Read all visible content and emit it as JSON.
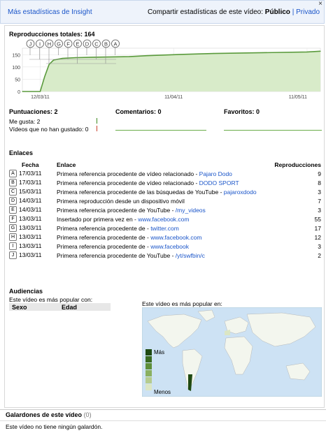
{
  "topbar": {
    "more_stats": "Más estadísticas de Insight",
    "share_label": "Compartir estadísticas de este vídeo:",
    "share_public": "Público",
    "share_sep": "|",
    "share_private": "Privado",
    "close": "×"
  },
  "views": {
    "title": "Reproducciones totales: 164",
    "markers": [
      "J",
      "I",
      "H",
      "G",
      "F",
      "E",
      "D",
      "C",
      "B",
      "A"
    ],
    "chart_data": {
      "type": "area",
      "x": [
        "08/03/11",
        "12/03/11",
        "13/03/11",
        "14/03/11",
        "15/03/11",
        "17/03/11",
        "20/03/11",
        "25/03/11",
        "01/04/11",
        "05/04/11",
        "11/04/11",
        "20/04/11",
        "01/05/11",
        "11/05/11",
        "14/05/11"
      ],
      "values": [
        0,
        0,
        60,
        110,
        128,
        135,
        138,
        140,
        142,
        146,
        150,
        155,
        158,
        161,
        164
      ],
      "yticks": [
        0,
        50,
        100,
        150
      ],
      "xticks": [
        "12/03/11",
        "11/04/11",
        "11/05/11"
      ],
      "ylim": [
        0,
        165
      ],
      "color": "#5a9a3c",
      "fill": "#d8ebc9"
    }
  },
  "ratings": {
    "score_title": "Puntuaciones: 2",
    "likes": "Me gusta: 2",
    "dislikes": "Vídeos que no han gustado: 0",
    "comments_title": "Comentarios: 0",
    "favorites_title": "Favoritos: 0"
  },
  "links": {
    "title": "Enlaces",
    "col_date": "Fecha",
    "col_link": "Enlace",
    "col_views": "Reproducciones",
    "rows": [
      {
        "letter": "A",
        "date": "17/03/11",
        "text": "Primera referencia procedente de vídeo relacionado - ",
        "link": "Pajaro Dodo",
        "views": "9"
      },
      {
        "letter": "B",
        "date": "17/03/11",
        "text": "Primera referencia procedente de vídeo relacionado - ",
        "link": "DODO SPORT",
        "views": "8"
      },
      {
        "letter": "C",
        "date": "15/03/11",
        "text": "Primera referencia procedente de las búsquedas de YouTube - ",
        "link": "pajaroxdodo",
        "views": "3"
      },
      {
        "letter": "D",
        "date": "14/03/11",
        "text": "Primera reproducción desde un dispositivo móvil",
        "link": "",
        "views": "7"
      },
      {
        "letter": "E",
        "date": "14/03/11",
        "text": "Primera referencia procedente de YouTube - ",
        "link": "/my_videos",
        "views": "3"
      },
      {
        "letter": "F",
        "date": "13/03/11",
        "text": "Insertado por primera vez en - ",
        "link": "www.facebook.com",
        "views": "55"
      },
      {
        "letter": "G",
        "date": "13/03/11",
        "text": "Primera referencia procedente de - ",
        "link": "twitter.com",
        "views": "17"
      },
      {
        "letter": "H",
        "date": "13/03/11",
        "text": "Primera referencia procedente de - ",
        "link": "www.facebook.com",
        "views": "12"
      },
      {
        "letter": "I",
        "date": "13/03/11",
        "text": "Primera referencia procedente de - ",
        "link": "www.facebook",
        "views": "3"
      },
      {
        "letter": "J",
        "date": "13/03/11",
        "text": "Primera referencia procedente de YouTube - ",
        "link": "/yt/swfbin/c",
        "views": "2"
      }
    ]
  },
  "audience": {
    "title": "Audiencias",
    "popular_with": "Este vídeo es más popular con:",
    "col_sex": "Sexo",
    "col_age": "Edad",
    "popular_in": "Este vídeo es más popular en:",
    "legend_more": "Más",
    "legend_less": "Menos",
    "legend_colors": [
      "#1f4a12",
      "#3a6b22",
      "#5e8f3a",
      "#8ab060",
      "#b5cc8f",
      "#dbe6c4"
    ]
  },
  "awards": {
    "title": "Galardones de este vídeo",
    "count": "(0)",
    "text": "Este vídeo no tiene ningún galardón."
  }
}
